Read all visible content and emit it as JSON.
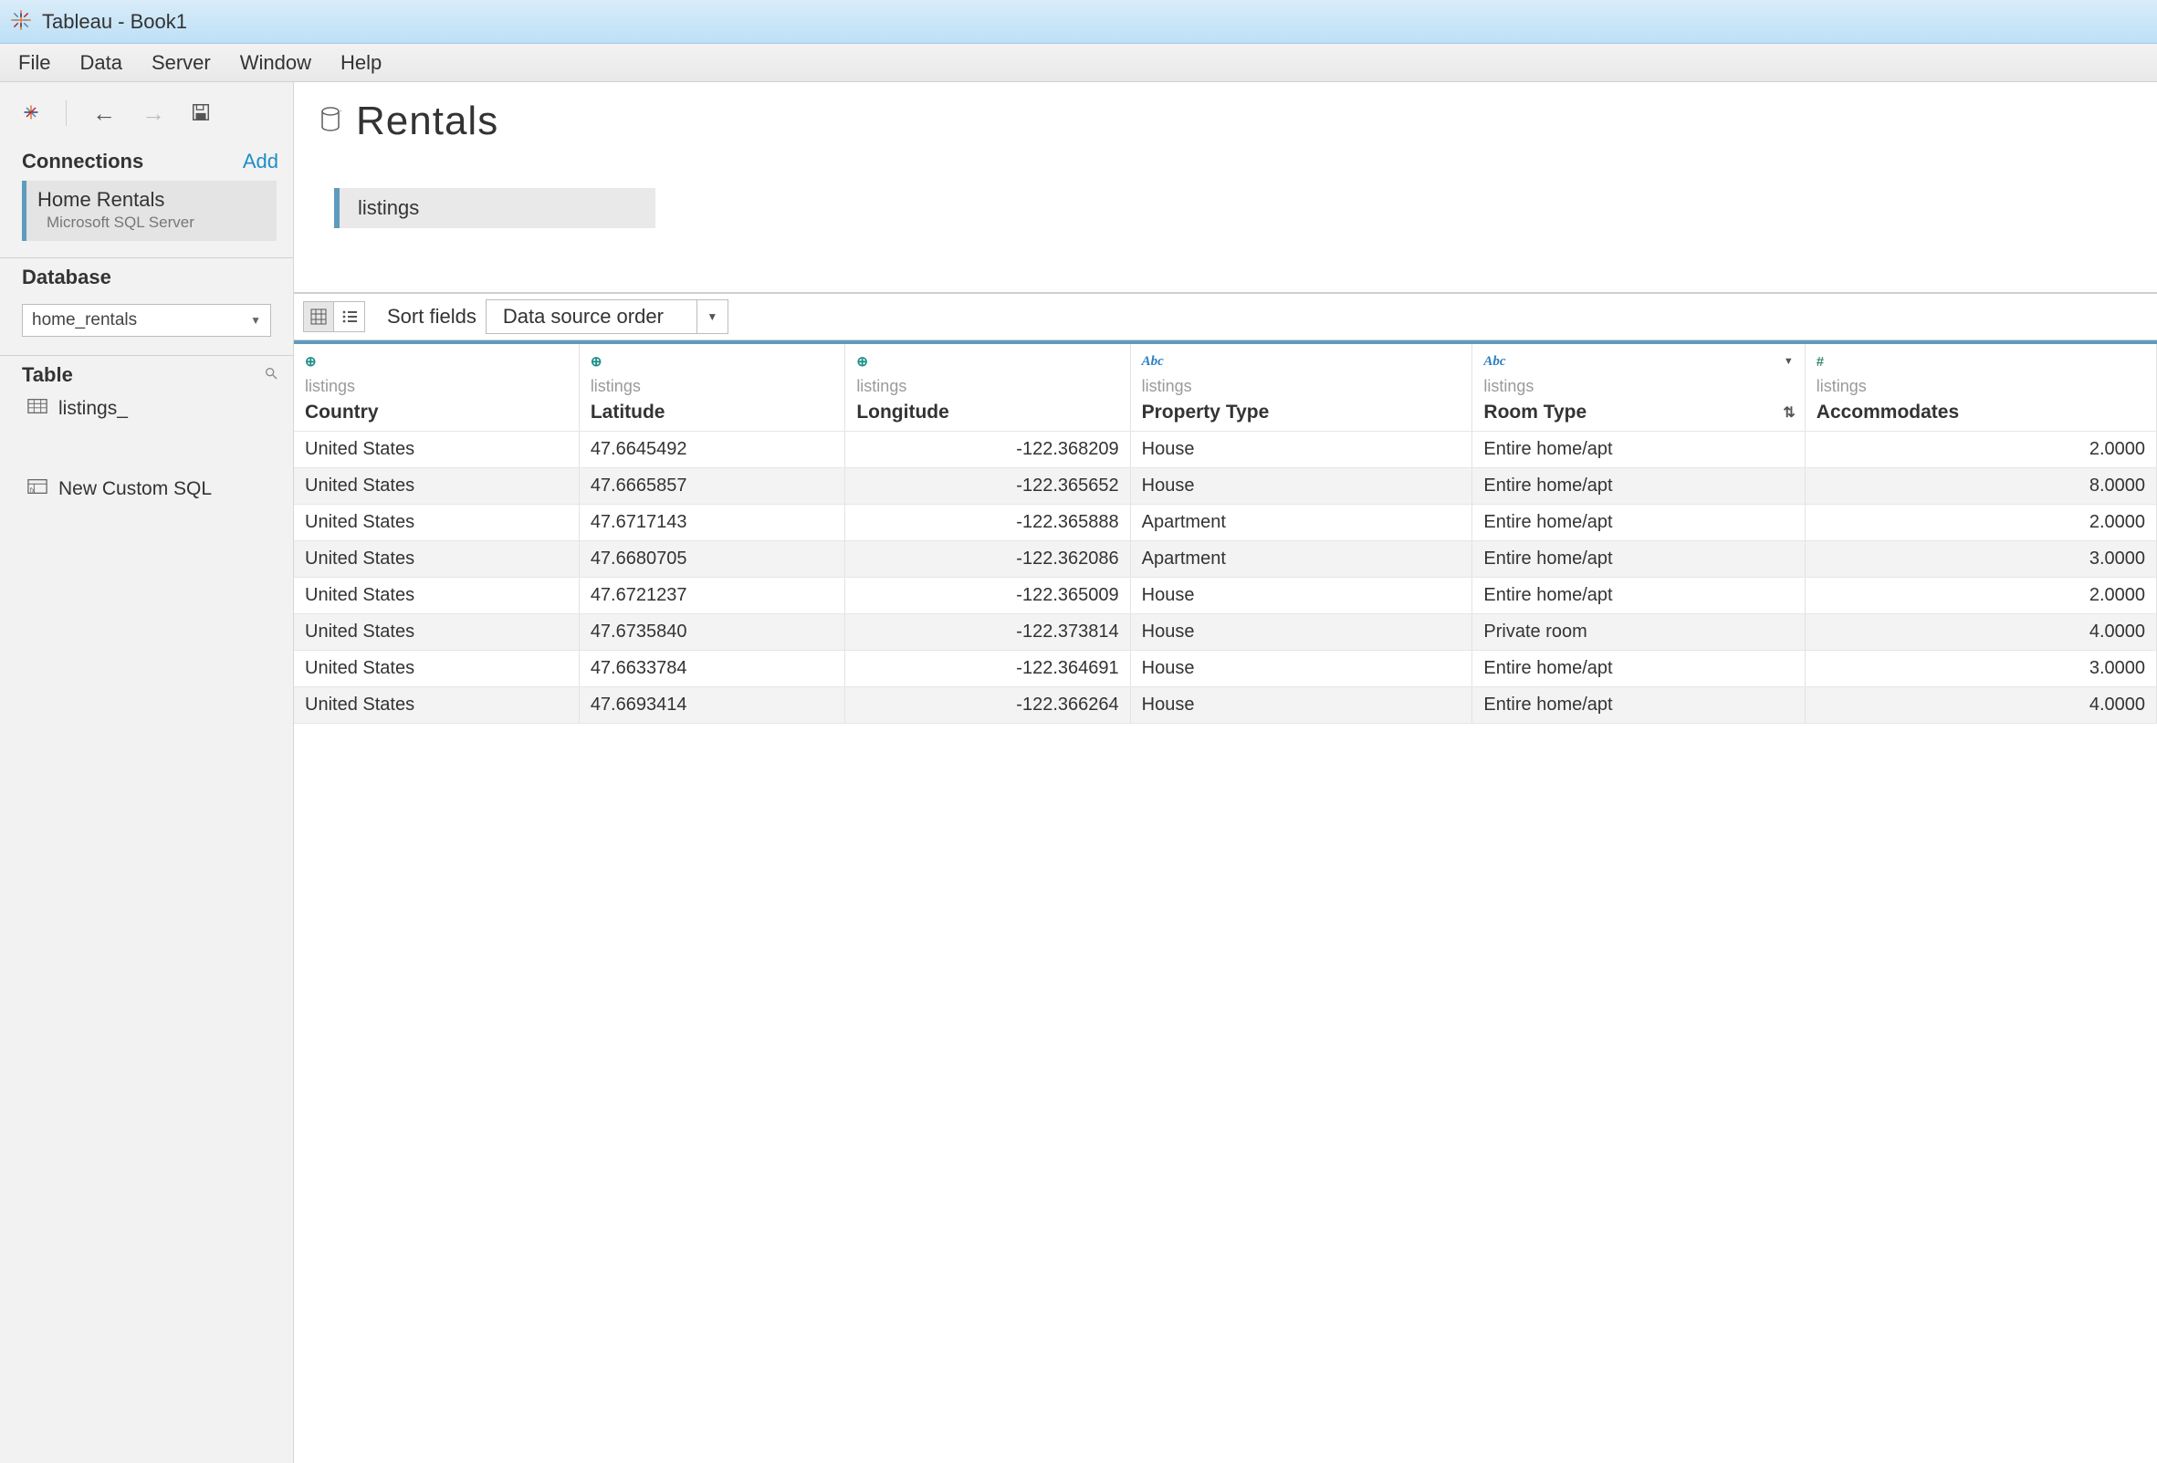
{
  "window": {
    "title": "Tableau - Book1"
  },
  "menus": [
    "File",
    "Data",
    "Server",
    "Window",
    "Help"
  ],
  "sidebar": {
    "connections_label": "Connections",
    "add_label": "Add",
    "connection": {
      "name": "Home Rentals",
      "type": "Microsoft SQL Server"
    },
    "database_label": "Database",
    "database_value": "home_rentals",
    "table_label": "Table",
    "table_item": "listings_",
    "custom_sql": "New Custom SQL"
  },
  "datasource": {
    "title": "Rentals",
    "canvas_table": "listings"
  },
  "grid_toolbar": {
    "sort_fields_label": "Sort fields",
    "sort_fields_value": "Data source order"
  },
  "columns": [
    {
      "type": "globe",
      "src": "listings",
      "name": "Country",
      "align": "left"
    },
    {
      "type": "globe",
      "src": "listings",
      "name": "Latitude",
      "align": "left"
    },
    {
      "type": "globe",
      "src": "listings",
      "name": "Longitude",
      "align": "right"
    },
    {
      "type": "abc",
      "src": "listings",
      "name": "Property Type",
      "align": "left"
    },
    {
      "type": "abc",
      "src": "listings",
      "name": "Room Type",
      "align": "left",
      "has_caret": true,
      "has_sort": true
    },
    {
      "type": "hash",
      "src": "listings",
      "name": "Accommodates",
      "align": "right"
    }
  ],
  "rows": [
    [
      "United States",
      "47.6645492",
      "-122.368209",
      "House",
      "Entire home/apt",
      "2.0000"
    ],
    [
      "United States",
      "47.6665857",
      "-122.365652",
      "House",
      "Entire home/apt",
      "8.0000"
    ],
    [
      "United States",
      "47.6717143",
      "-122.365888",
      "Apartment",
      "Entire home/apt",
      "2.0000"
    ],
    [
      "United States",
      "47.6680705",
      "-122.362086",
      "Apartment",
      "Entire home/apt",
      "3.0000"
    ],
    [
      "United States",
      "47.6721237",
      "-122.365009",
      "House",
      "Entire home/apt",
      "2.0000"
    ],
    [
      "United States",
      "47.6735840",
      "-122.373814",
      "House",
      "Private room",
      "4.0000"
    ],
    [
      "United States",
      "47.6633784",
      "-122.364691",
      "House",
      "Entire home/apt",
      "3.0000"
    ],
    [
      "United States",
      "47.6693414",
      "-122.366264",
      "House",
      "Entire home/apt",
      "4.0000"
    ]
  ]
}
